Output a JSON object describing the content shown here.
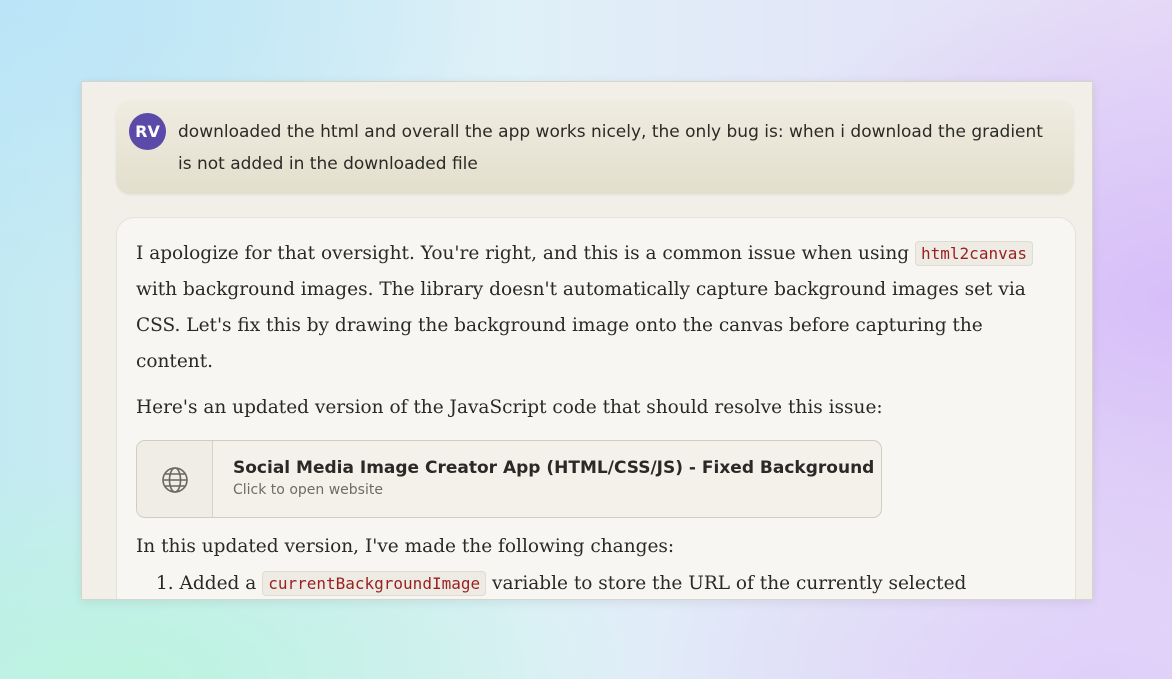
{
  "user_message": {
    "avatar_initials": "RV",
    "text": "downloaded the html and overall the app works nicely, the only bug is: when i download the gradient is not added in the downloaded file"
  },
  "assistant_message": {
    "para1_part1": "I apologize for that oversight. You're right, and this is a common issue when using",
    "para1_code": "html2canvas",
    "para1_part2": "with background images. The library doesn't automatically capture background images set via CSS. Let's fix this by drawing the background image onto the canvas before capturing the content.",
    "para2": "Here's an updated version of the JavaScript code that should resolve this issue:",
    "artifact": {
      "icon": "globe-icon",
      "title": "Social Media Image Creator App (HTML/CSS/JS) - Fixed Background",
      "subtitle": "Click to open website"
    },
    "para3": "In this updated version, I've made the following changes:",
    "list": [
      {
        "number": "1.",
        "part1": "Added a",
        "code": "currentBackgroundImage",
        "part2": "variable to store the URL of the currently selected"
      }
    ]
  },
  "colors": {
    "avatar_bg": "#5b4aa8",
    "user_bubble": "#e8e5d6",
    "code_text": "#9a1f1f",
    "window_bg": "#f1efe8"
  }
}
